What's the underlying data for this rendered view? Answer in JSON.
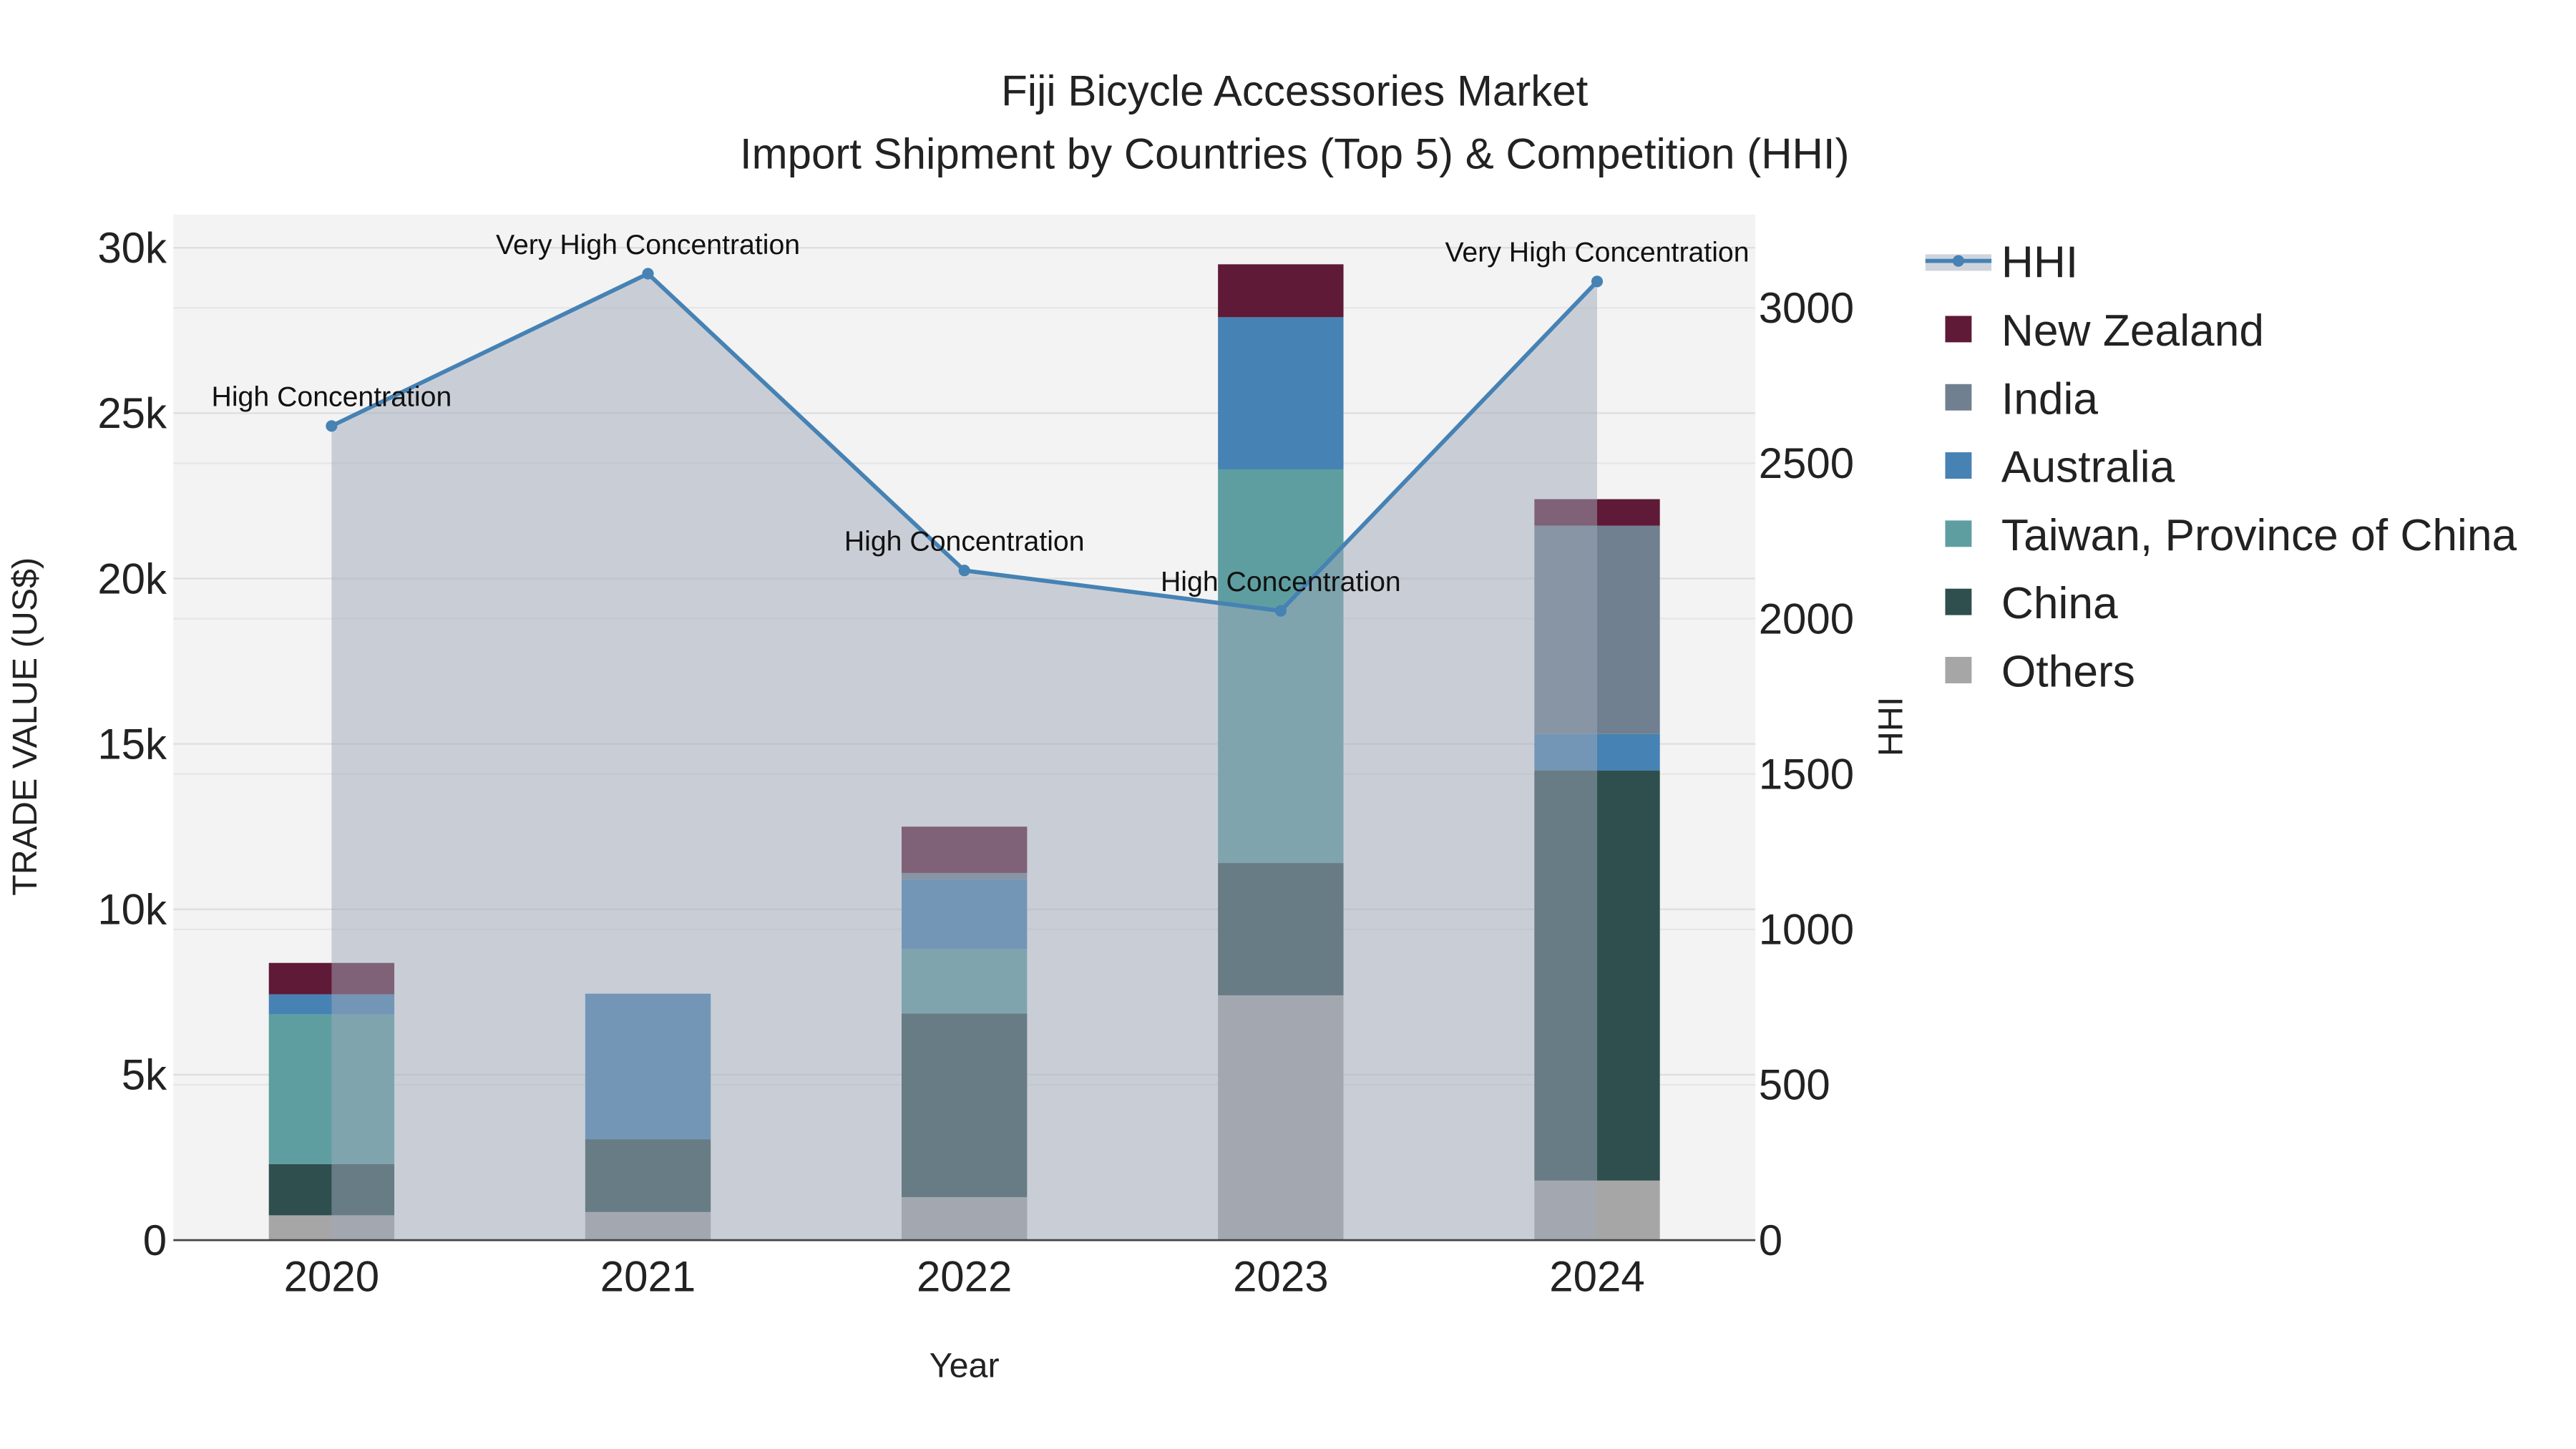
{
  "chart_data": {
    "type": "bar",
    "title": "Fiji Bicycle Accessories Market",
    "subtitle": "Import Shipment by Countries (Top 5) & Competition (HHI)",
    "xlabel": "Year",
    "ylabel": "TRADE VALUE (US$)",
    "y2label": "HHI",
    "categories": [
      "2020",
      "2021",
      "2022",
      "2023",
      "2024"
    ],
    "ylim": [
      0,
      31000
    ],
    "y2lim": [
      0,
      3300
    ],
    "yticks": [
      0,
      5000,
      10000,
      15000,
      20000,
      25000,
      30000
    ],
    "ytick_labels": [
      "0",
      "5k",
      "10k",
      "15k",
      "20k",
      "25k",
      "30k"
    ],
    "y2ticks": [
      0,
      500,
      1000,
      1500,
      2000,
      2500,
      3000
    ],
    "y2tick_labels": [
      "0",
      "500",
      "1000",
      "1500",
      "2000",
      "2500",
      "3000"
    ],
    "stacked": true,
    "series": [
      {
        "name": "Others",
        "color": "#a6a6a6",
        "values": [
          750,
          850,
          1300,
          7400,
          1800
        ]
      },
      {
        "name": "China",
        "color": "#2f4f4f",
        "values": [
          1550,
          2200,
          5550,
          4000,
          12400
        ]
      },
      {
        "name": "Taiwan, Province of China",
        "color": "#5f9ea0",
        "values": [
          4520,
          0,
          1950,
          11900,
          0
        ]
      },
      {
        "name": "Australia",
        "color": "#4682b4",
        "values": [
          610,
          4400,
          2100,
          4600,
          1100
        ]
      },
      {
        "name": "India",
        "color": "#708090",
        "values": [
          0,
          0,
          200,
          0,
          6300
        ]
      },
      {
        "name": "New Zealand",
        "color": "#5f1a37",
        "values": [
          950,
          0,
          1400,
          1600,
          800
        ]
      }
    ],
    "hhi": {
      "name": "HHI",
      "color": "#4682b4",
      "values": [
        2620,
        3110,
        2155,
        2025,
        3085
      ],
      "annotations": [
        "High Concentration",
        "Very High Concentration",
        "High Concentration",
        "High Concentration",
        "Very High Concentration"
      ]
    },
    "legend_order": [
      "HHI",
      "New Zealand",
      "India",
      "Australia",
      "Taiwan, Province of China",
      "China",
      "Others"
    ],
    "legend_placement": "right",
    "grid": true
  }
}
